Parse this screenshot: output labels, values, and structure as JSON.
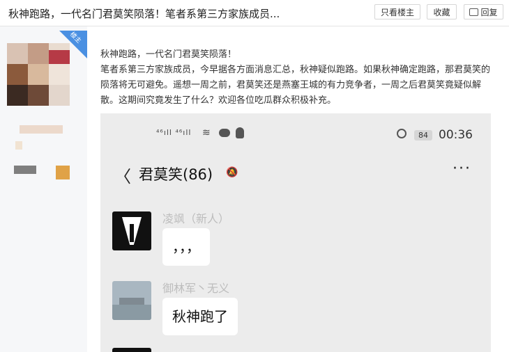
{
  "header": {
    "title": "秋神跑路，一代名门君莫笑陨落！笔者系第三方家族成员...",
    "op_only_label": "只看楼主",
    "favorite_label": "收藏",
    "reply_label": "回复"
  },
  "sidebar": {
    "badge_label": "楼主"
  },
  "post": {
    "lines": [
      "秋神跑路，一代名门君莫笑陨落！",
      "笔者系第三方家族成员，今早据各方面消息汇总，秋神疑似跑路。如果秋神确定跑路，那君莫笑的陨落将无可避免。遥想一周之前，君莫笑还是燕塞王城的有力竞争者，一周之后君莫笑竟疑似解散。这期间究竟发生了什么？欢迎各位吃瓜群众积极补充。"
    ]
  },
  "screenshot": {
    "signals": "⁴⁶ıll ⁴⁶ıll",
    "battery": "84",
    "time": "00:36",
    "back": "〈",
    "chat_title": "君莫笑(86)",
    "more": "···",
    "messages": [
      {
        "name": "凌飒（新人）",
        "text": "，，，"
      },
      {
        "name": "御林军丶无义",
        "text": "秋神跑了"
      }
    ]
  },
  "colors": {
    "accent": "#4a90e2",
    "sidebar_bg": "#f6f7f9",
    "chat_bg": "#ececec"
  }
}
